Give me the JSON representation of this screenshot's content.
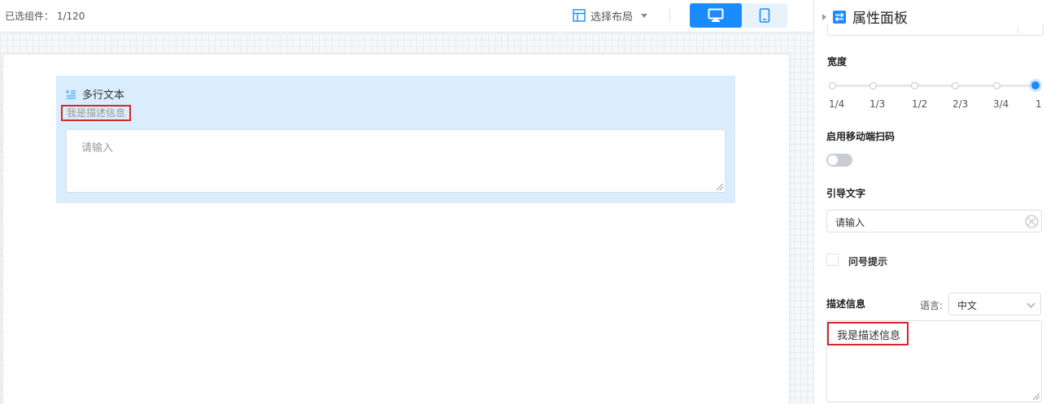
{
  "toolbar": {
    "selected_label": "已选组件：",
    "selected_count": "1/120",
    "layout_label": "选择布局",
    "desktop_icon": "desktop-icon",
    "mobile_icon": "mobile-icon"
  },
  "canvas": {
    "field": {
      "icon": "multiline-text-icon",
      "title": "多行文本",
      "description": "我是描述信息",
      "placeholder": "请输入"
    }
  },
  "panel": {
    "title": "属性面板",
    "width": {
      "label": "宽度",
      "ticks": [
        "1/4",
        "1/3",
        "1/2",
        "2/3",
        "3/4",
        "1"
      ],
      "selected": "1"
    },
    "mobile_scan": {
      "label": "启用移动端扫码",
      "enabled": false
    },
    "guide_text": {
      "label": "引导文字",
      "value": "请输入"
    },
    "question_tip": {
      "label": "问号提示",
      "checked": false
    },
    "description": {
      "label": "描述信息",
      "lang_label": "语言:",
      "lang_value": "中文",
      "value": "我是描述信息"
    }
  },
  "colors": {
    "accent": "#1a8cff",
    "field_bg": "#d9edfc",
    "highlight": "#d9262a"
  }
}
